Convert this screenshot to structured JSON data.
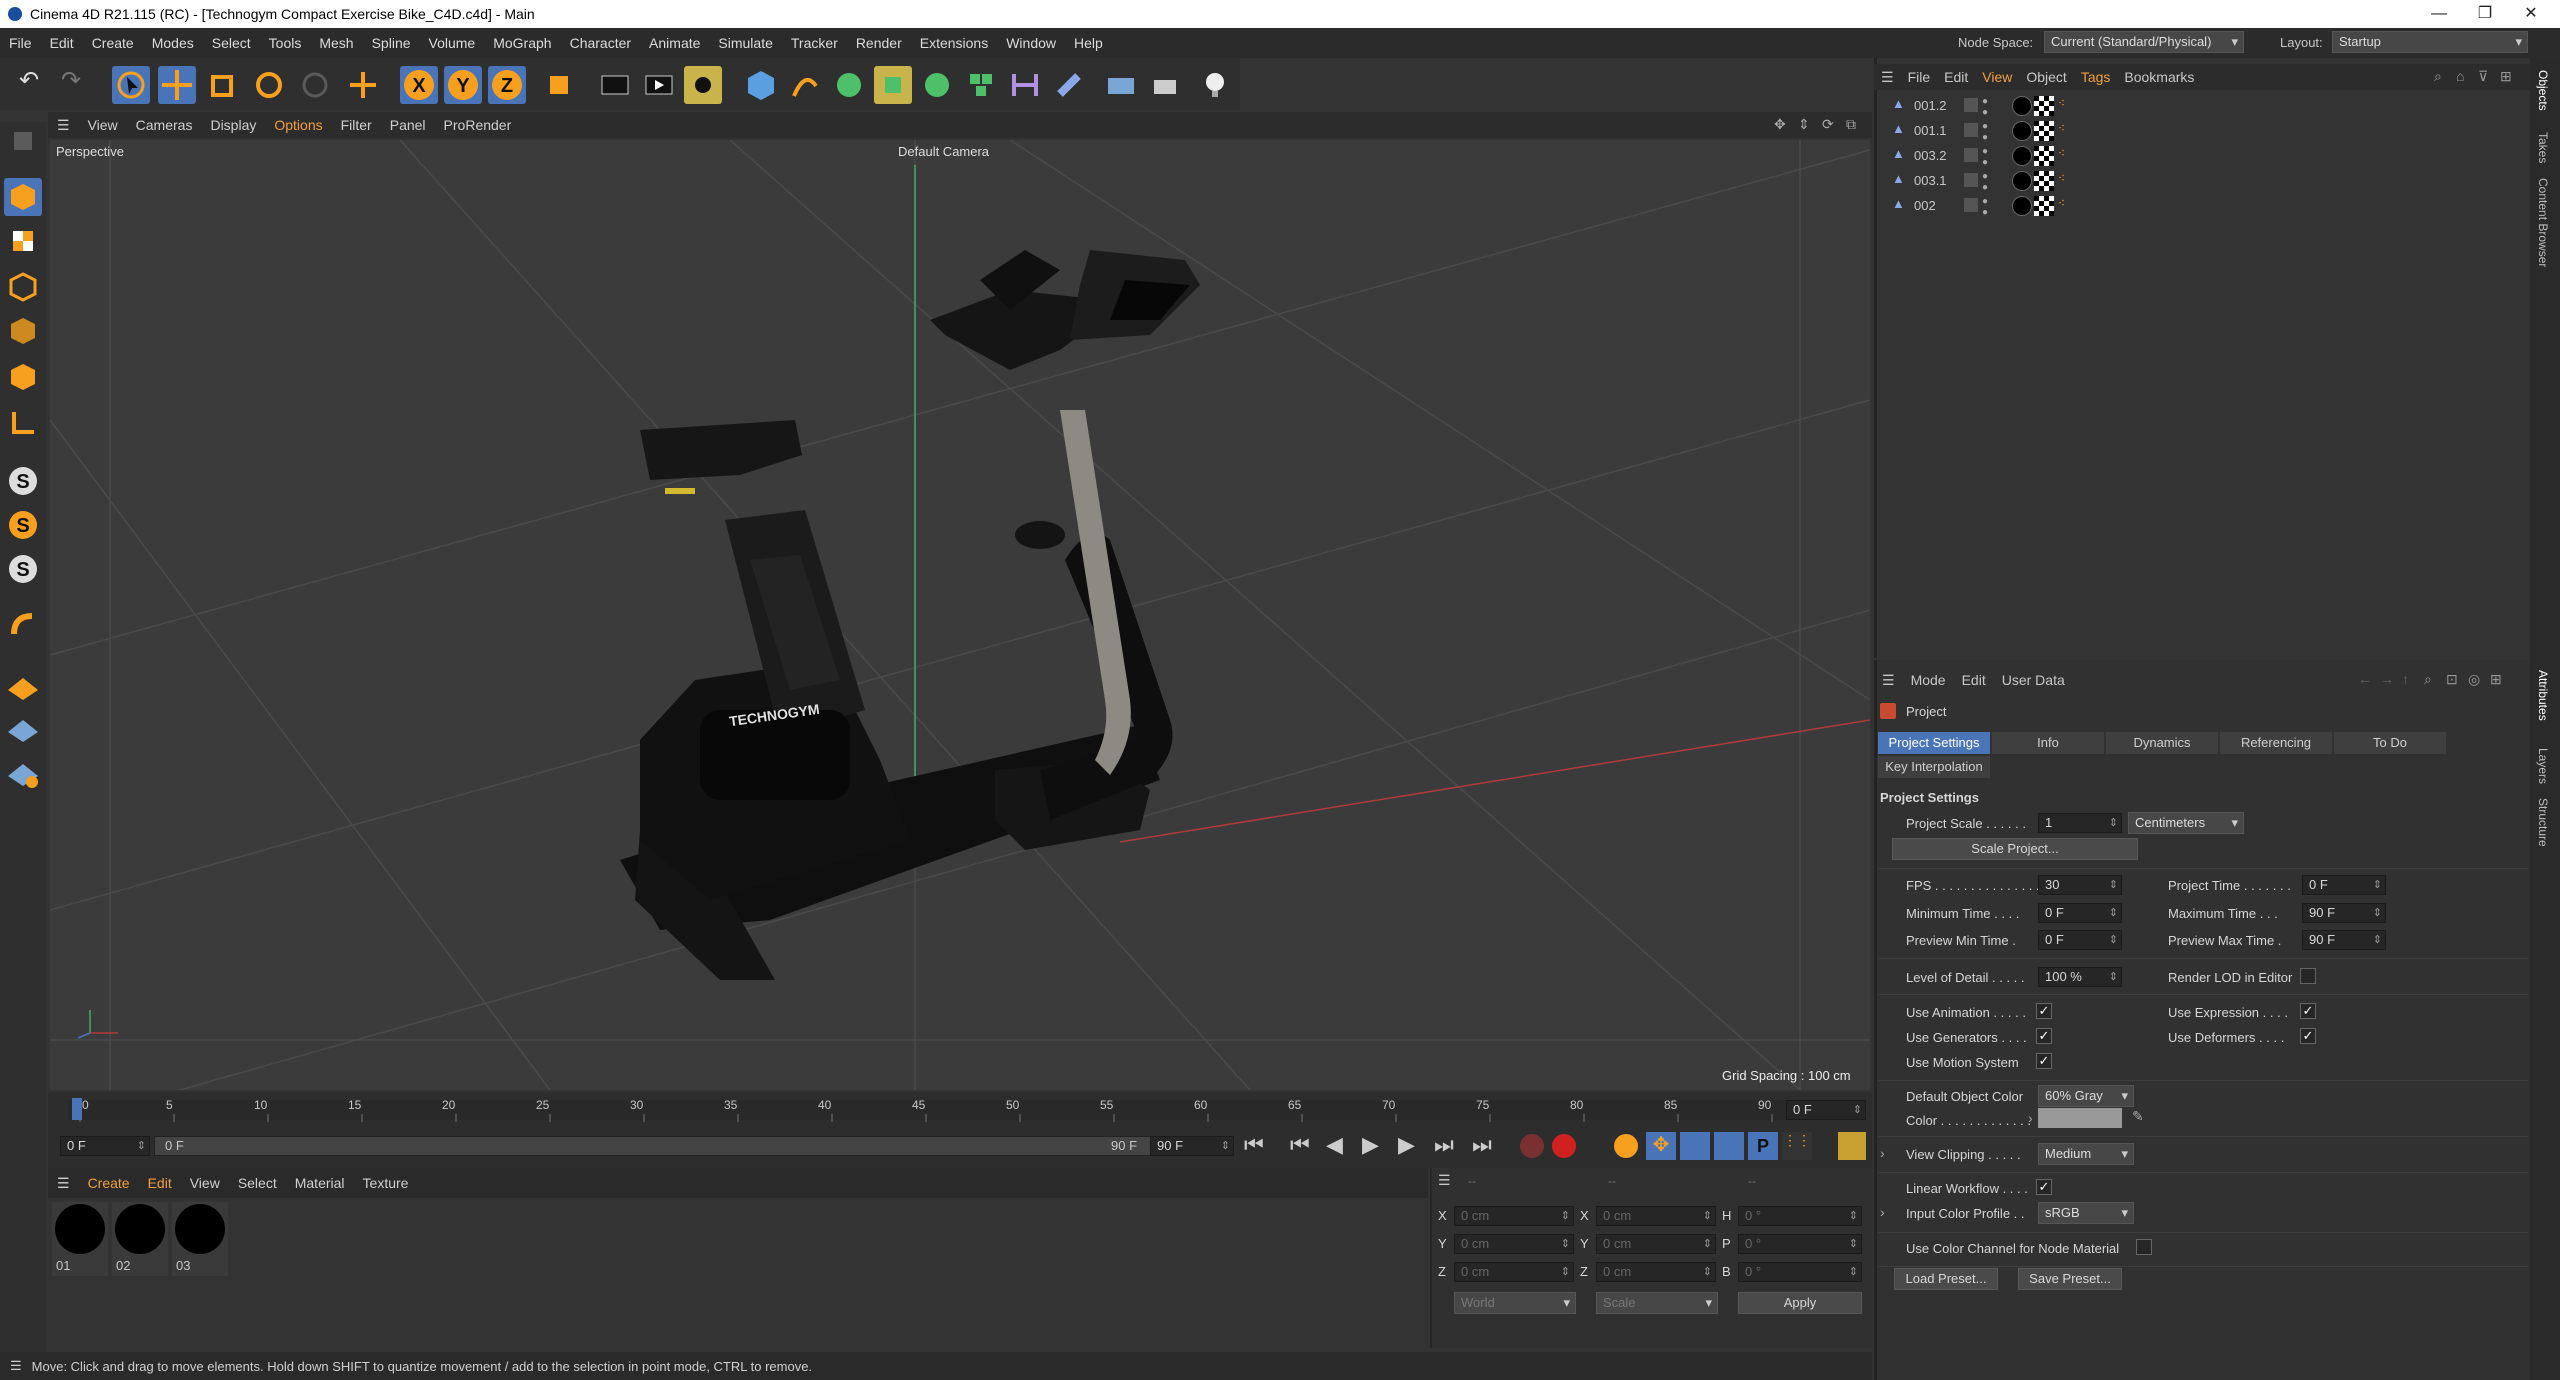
{
  "window": {
    "title": "Cinema 4D R21.115 (RC) - [Technogym Compact Exercise Bike_C4D.c4d] - Main",
    "minimize": "—",
    "maximize": "❐",
    "close": "✕"
  },
  "menubar": {
    "items": [
      "File",
      "Edit",
      "Create",
      "Modes",
      "Select",
      "Tools",
      "Mesh",
      "Spline",
      "Volume",
      "MoGraph",
      "Character",
      "Animate",
      "Simulate",
      "Tracker",
      "Render",
      "Extensions",
      "Window",
      "Help"
    ],
    "node_space_label": "Node Space:",
    "node_space_value": "Current (Standard/Physical)",
    "layout_label": "Layout:",
    "layout_value": "Startup"
  },
  "viewport": {
    "menu": [
      "View",
      "Cameras",
      "Display",
      "Options",
      "Filter",
      "Panel",
      "ProRender"
    ],
    "name": "Perspective",
    "camera": "Default Camera",
    "grid_spacing": "Grid Spacing : 100 cm",
    "bike_logo": "TECHNOGYM"
  },
  "timeline": {
    "ticks": [
      "0",
      "5",
      "10",
      "15",
      "20",
      "25",
      "30",
      "35",
      "40",
      "45",
      "50",
      "55",
      "60",
      "65",
      "70",
      "75",
      "80",
      "85",
      "90"
    ],
    "current_frame": "0 F",
    "start_field": "0 F",
    "range_start": "0 F",
    "range_end": "90 F",
    "end_field": "90 F"
  },
  "materials": {
    "menu": [
      "Create",
      "Edit",
      "View",
      "Select",
      "Material",
      "Texture"
    ],
    "items": [
      "01",
      "02",
      "03"
    ]
  },
  "coords": {
    "header": [
      "--",
      "--",
      "--"
    ],
    "rows": [
      {
        "a": "X",
        "av": "0 cm",
        "b": "X",
        "bv": "0 cm",
        "c": "H",
        "cv": "0 °"
      },
      {
        "a": "Y",
        "av": "0 cm",
        "b": "Y",
        "bv": "0 cm",
        "c": "P",
        "cv": "0 °"
      },
      {
        "a": "Z",
        "av": "0 cm",
        "b": "Z",
        "bv": "0 cm",
        "c": "B",
        "cv": "0 °"
      }
    ],
    "world": "World",
    "scale": "Scale",
    "apply": "Apply"
  },
  "status": "Move: Click and drag to move elements. Hold down SHIFT to quantize movement / add to the selection in point mode, CTRL to remove.",
  "objects": {
    "menu": [
      "File",
      "Edit",
      "View",
      "Object",
      "Tags",
      "Bookmarks"
    ],
    "items": [
      "001.2",
      "001.1",
      "003.2",
      "003.1",
      "002"
    ]
  },
  "attributes": {
    "menu": [
      "Mode",
      "Edit",
      "User Data"
    ],
    "object": "Project",
    "tabs": [
      "Project Settings",
      "Info",
      "Dynamics",
      "Referencing",
      "To Do"
    ],
    "tab2": "Key Interpolation",
    "section": "Project Settings",
    "project_scale_label": "Project Scale . . . . . .",
    "project_scale": "1",
    "units": "Centimeters",
    "scale_project": "Scale Project...",
    "fps_label": "FPS . . . . . . . . . . . . . . .",
    "fps": "30",
    "project_time_label": "Project Time . . . . . . .",
    "project_time": "0 F",
    "min_time_label": "Minimum Time . . . .",
    "min_time": "0 F",
    "max_time_label": "Maximum Time . . .",
    "max_time": "90 F",
    "pmin_label": "Preview Min Time .",
    "pmin": "0 F",
    "pmax_label": "Preview Max Time .",
    "pmax": "90 F",
    "lod_label": "Level of Detail . . . . .",
    "lod": "100 %",
    "render_lod_label": "Render LOD in Editor",
    "use_anim_label": "Use Animation . . . . .",
    "use_expr_label": "Use Expression . . . .",
    "use_gen_label": "Use Generators . . . .",
    "use_def_label": "Use Deformers . . . .",
    "use_motion_label": "Use Motion System",
    "def_color_label": "Default Object Color",
    "def_color": "60% Gray",
    "color_label": "Color . . . . . . . . . . . . .",
    "view_clip_label": "View Clipping . . . . .",
    "view_clip": "Medium",
    "linear_label": "Linear Workflow . . . .",
    "icp_label": "Input Color Profile . .",
    "icp": "sRGB",
    "node_mat_label": "Use Color Channel for Node Material",
    "load_preset": "Load Preset...",
    "save_preset": "Save Preset..."
  },
  "right_tabs": [
    "Objects",
    "Takes",
    "Content Browser",
    "Attributes",
    "Layers",
    "Structure"
  ],
  "colors": {
    "accent": "#4a74b8",
    "bg": "#333333",
    "axis_green": "#3fae6a",
    "axis_red": "#b03a3a"
  }
}
